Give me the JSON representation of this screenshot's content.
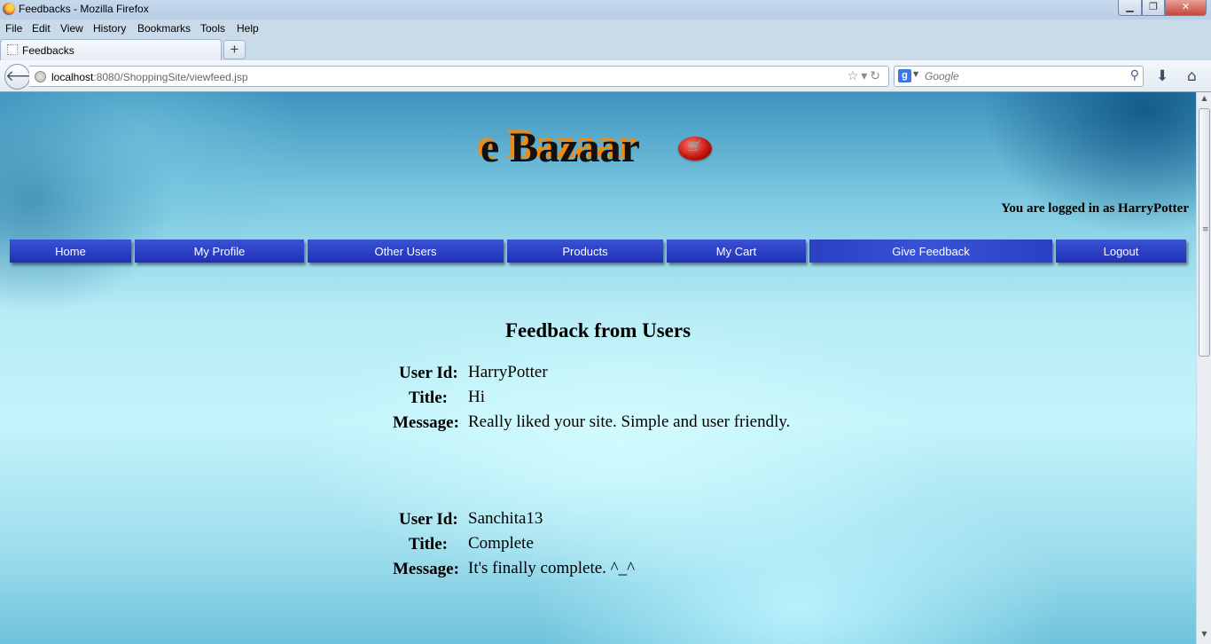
{
  "window": {
    "title": "Feedbacks - Mozilla Firefox"
  },
  "menu": [
    "File",
    "Edit",
    "View",
    "History",
    "Bookmarks",
    "Tools",
    "Help"
  ],
  "tab": {
    "label": "Feedbacks",
    "new_tab": "+"
  },
  "address": {
    "host": "localhost",
    "rest": ":8080/ShoppingSite/viewfeed.jsp"
  },
  "search": {
    "placeholder": "Google"
  },
  "site": {
    "title": "e Bazaar",
    "logged_in_text": "You are logged in as HarryPotter"
  },
  "nav": [
    "Home",
    "My Profile",
    "Other Users",
    "Products",
    "My Cart",
    "Give Feedback",
    "Logout"
  ],
  "feedback": {
    "heading": "Feedback from Users",
    "labels": {
      "user_id": "User Id:",
      "title": "Title:",
      "message": "Message:"
    },
    "entries": [
      {
        "user_id": "HarryPotter",
        "title": "Hi",
        "message": "Really liked your site. Simple and user friendly."
      },
      {
        "user_id": "Sanchita13",
        "title": "Complete",
        "message": "It's finally complete. ^_^"
      }
    ]
  },
  "colors": {
    "accent_orange": "#f28a10",
    "nav_blue": "#2536c4"
  }
}
